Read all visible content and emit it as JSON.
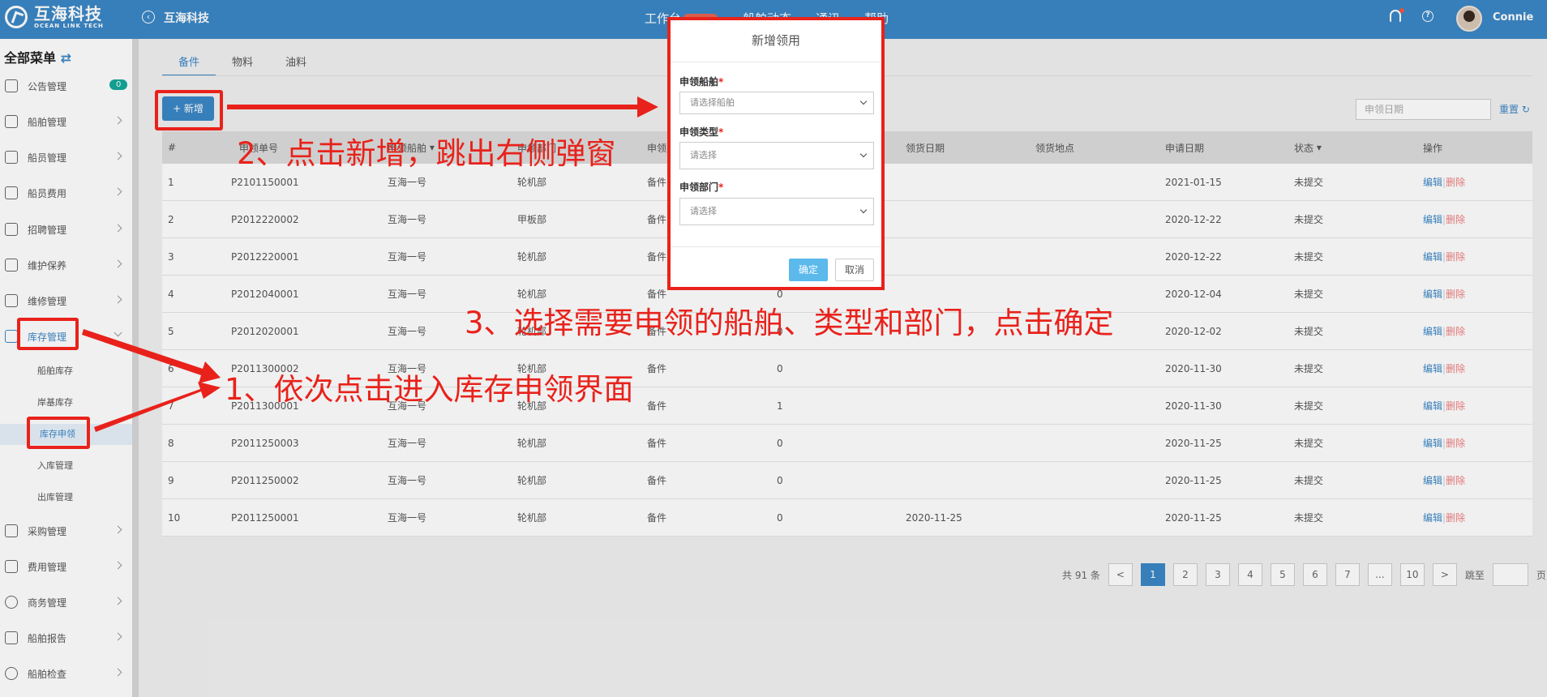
{
  "header": {
    "logo_cn": "互海科技",
    "logo_en": "OCEAN LINK TECH",
    "company": "互海科技",
    "nav": [
      "工作台",
      "船舶动态",
      "通讯",
      "帮助"
    ],
    "user": "Connie"
  },
  "sidebar": {
    "title": "全部菜单",
    "notice_count": "0",
    "items": [
      "公告管理",
      "船舶管理",
      "船员管理",
      "船员费用",
      "招聘管理",
      "维护保养",
      "维修管理",
      "库存管理",
      "采购管理",
      "费用管理",
      "商务管理",
      "船舶报告",
      "船舶检查"
    ],
    "sub_items": [
      "船舶库存",
      "岸基库存",
      "库存申领",
      "入库管理",
      "出库管理"
    ]
  },
  "main": {
    "tabs": [
      "备件",
      "物料",
      "油料"
    ],
    "add_label": "+ 新增",
    "date_placeholder": "申领日期",
    "reset_label": "重置",
    "columns": [
      "#",
      "申领单号",
      "申领船舶",
      "申领部门",
      "申领类型",
      "",
      "领货日期",
      "领货地点",
      "申请日期",
      "状态",
      "操作"
    ],
    "rows": [
      {
        "no": "1",
        "code": "P2101150001",
        "ship": "互海一号",
        "dept": "轮机部",
        "type": "备件",
        "qty": "",
        "pick_date": "",
        "place": "",
        "apply_date": "2021-01-15",
        "status": "未提交"
      },
      {
        "no": "2",
        "code": "P2012220002",
        "ship": "互海一号",
        "dept": "甲板部",
        "type": "备件",
        "qty": "",
        "pick_date": "",
        "place": "",
        "apply_date": "2020-12-22",
        "status": "未提交"
      },
      {
        "no": "3",
        "code": "P2012220001",
        "ship": "互海一号",
        "dept": "轮机部",
        "type": "备件",
        "qty": "",
        "pick_date": "",
        "place": "",
        "apply_date": "2020-12-22",
        "status": "未提交"
      },
      {
        "no": "4",
        "code": "P2012040001",
        "ship": "互海一号",
        "dept": "轮机部",
        "type": "备件",
        "qty": "0",
        "pick_date": "",
        "place": "",
        "apply_date": "2020-12-04",
        "status": "未提交"
      },
      {
        "no": "5",
        "code": "P2012020001",
        "ship": "互海一号",
        "dept": "轮机部",
        "type": "备件",
        "qty": "0",
        "pick_date": "",
        "place": "",
        "apply_date": "2020-12-02",
        "status": "未提交"
      },
      {
        "no": "6",
        "code": "P2011300002",
        "ship": "互海一号",
        "dept": "轮机部",
        "type": "备件",
        "qty": "0",
        "pick_date": "",
        "place": "",
        "apply_date": "2020-11-30",
        "status": "未提交"
      },
      {
        "no": "7",
        "code": "P2011300001",
        "ship": "互海一号",
        "dept": "轮机部",
        "type": "备件",
        "qty": "1",
        "pick_date": "",
        "place": "",
        "apply_date": "2020-11-30",
        "status": "未提交"
      },
      {
        "no": "8",
        "code": "P2011250003",
        "ship": "互海一号",
        "dept": "轮机部",
        "type": "备件",
        "qty": "0",
        "pick_date": "",
        "place": "",
        "apply_date": "2020-11-25",
        "status": "未提交"
      },
      {
        "no": "9",
        "code": "P2011250002",
        "ship": "互海一号",
        "dept": "轮机部",
        "type": "备件",
        "qty": "0",
        "pick_date": "",
        "place": "",
        "apply_date": "2020-11-25",
        "status": "未提交"
      },
      {
        "no": "10",
        "code": "P2011250001",
        "ship": "互海一号",
        "dept": "轮机部",
        "type": "备件",
        "qty": "0",
        "pick_date": "2020-11-25",
        "place": "",
        "apply_date": "2020-11-25",
        "status": "未提交"
      }
    ],
    "edit_label": "编辑",
    "delete_label": "删除",
    "pager": {
      "total": "共 91 条",
      "prev": "<",
      "pages": [
        "1",
        "2",
        "3",
        "4",
        "5",
        "6",
        "7",
        "...",
        "10"
      ],
      "next": ">",
      "jump": "跳至",
      "page_unit": "页"
    }
  },
  "modal": {
    "title": "新增领用",
    "ship_label": "申领船舶",
    "ship_placeholder": "请选择船舶",
    "type_label": "申领类型",
    "type_placeholder": "请选择",
    "dept_label": "申领部门",
    "dept_placeholder": "请选择",
    "required": "*",
    "ok": "确定",
    "cancel": "取消"
  },
  "annotations": {
    "step1": "1、依次点击进入库存申领界面",
    "step2": "2、点击新增，跳出右侧弹窗",
    "step3": "3、选择需要申领的船舶、类型和部门，点击确定"
  },
  "colors": {
    "header": "#3b87c6",
    "accent": "#3b87c6",
    "annotation": "#e8221b",
    "badge": "#14a89a"
  }
}
